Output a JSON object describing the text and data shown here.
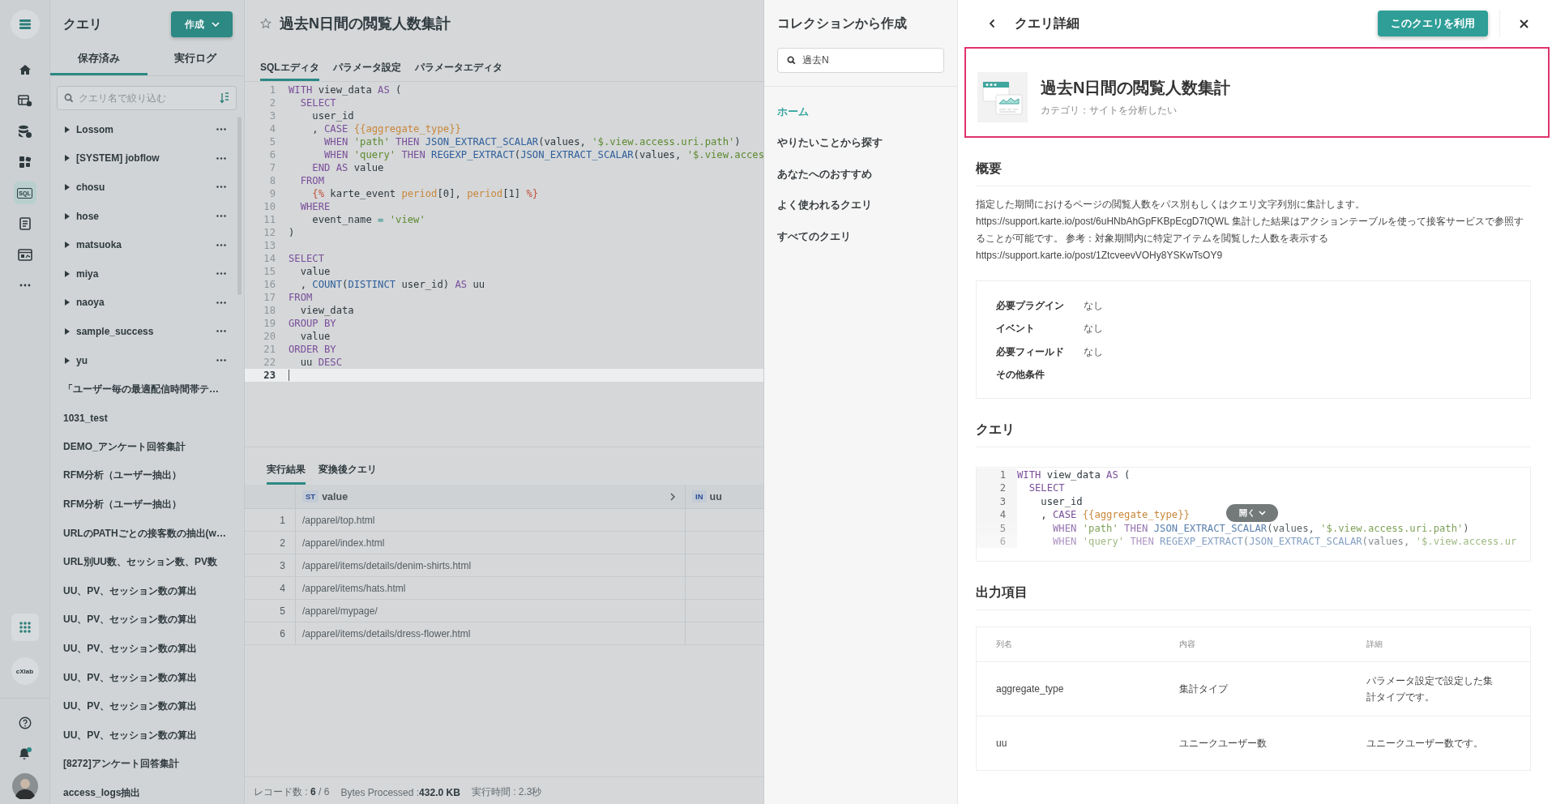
{
  "rail": {
    "items": [
      {
        "kind": "home",
        "selected": false
      },
      {
        "kind": "table",
        "selected": false
      },
      {
        "kind": "database",
        "selected": false
      },
      {
        "kind": "puzzle",
        "selected": false
      },
      {
        "kind": "sql",
        "label": "SQL",
        "selected": true
      },
      {
        "kind": "document",
        "selected": false
      },
      {
        "kind": "dashboard",
        "selected": false
      },
      {
        "kind": "more",
        "selected": false
      }
    ],
    "bottom": [
      {
        "kind": "apps"
      },
      {
        "kind": "project",
        "label": "cXlab"
      },
      {
        "kind": "help"
      },
      {
        "kind": "notifications",
        "badge": true
      },
      {
        "kind": "avatar"
      }
    ]
  },
  "sidebar": {
    "title": "クエリ",
    "create_button": "作成",
    "tabs": [
      {
        "label": "保存済み",
        "selected": true
      },
      {
        "label": "実行ログ",
        "selected": false
      }
    ],
    "search": {
      "placeholder": "クエリ名で絞り込む"
    },
    "items": [
      {
        "kind": "folder",
        "name": "Lossom"
      },
      {
        "kind": "folder",
        "name": "[SYSTEM] jobflow"
      },
      {
        "kind": "folder",
        "name": "chosu"
      },
      {
        "kind": "folder",
        "name": "hose"
      },
      {
        "kind": "folder",
        "name": "matsuoka"
      },
      {
        "kind": "folder",
        "name": "miya"
      },
      {
        "kind": "folder",
        "name": "naoya"
      },
      {
        "kind": "folder",
        "name": "sample_success"
      },
      {
        "kind": "folder",
        "name": "yu"
      },
      {
        "kind": "query",
        "name": "「ユーザー毎の最適配信時間帯テ…"
      },
      {
        "kind": "query",
        "name": "1031_test"
      },
      {
        "kind": "query",
        "name": "DEMO_アンケート回答集計"
      },
      {
        "kind": "query",
        "name": "RFM分析（ユーザー抽出）"
      },
      {
        "kind": "query",
        "name": "RFM分析（ユーザー抽出）"
      },
      {
        "kind": "query",
        "name": "URLのPATHごとの接客数の抽出(w…"
      },
      {
        "kind": "query",
        "name": "URL別UU数、セッション数、PV数"
      },
      {
        "kind": "query",
        "name": "UU、PV、セッション数の算出"
      },
      {
        "kind": "query",
        "name": "UU、PV、セッション数の算出"
      },
      {
        "kind": "query",
        "name": "UU、PV、セッション数の算出"
      },
      {
        "kind": "query",
        "name": "UU、PV、セッション数の算出"
      },
      {
        "kind": "query",
        "name": "UU、PV、セッション数の算出"
      },
      {
        "kind": "query",
        "name": "UU、PV、セッション数の算出"
      },
      {
        "kind": "query",
        "name": "[8272]アンケート回答集計"
      },
      {
        "kind": "query",
        "name": "access_logs抽出"
      }
    ]
  },
  "editor": {
    "title": "過去N日間の閲覧人数集計",
    "starred": false,
    "tabs": [
      {
        "label": "SQLエディタ",
        "selected": true
      },
      {
        "label": "パラメータ設定",
        "selected": false
      },
      {
        "label": "パラメータエディタ",
        "selected": false
      }
    ],
    "lines": [
      {
        "number": "1",
        "current": false,
        "tokens": [
          {
            "kind": "kw",
            "text": "WITH"
          },
          {
            "kind": "txt",
            "text": " view_data "
          },
          {
            "kind": "kw",
            "text": "AS"
          },
          {
            "kind": "txt",
            "text": " ("
          }
        ]
      },
      {
        "number": "2",
        "current": false,
        "tokens": [
          {
            "kind": "kw",
            "text": "  SELECT"
          }
        ]
      },
      {
        "number": "3",
        "current": false,
        "tokens": [
          {
            "kind": "txt",
            "text": "    user_id"
          }
        ]
      },
      {
        "number": "4",
        "current": false,
        "tokens": [
          {
            "kind": "txt",
            "text": "    , "
          },
          {
            "kind": "kw",
            "text": "CASE"
          },
          {
            "kind": "tpl",
            "text": " {{aggregate_type}}"
          }
        ]
      },
      {
        "number": "5",
        "current": false,
        "tokens": [
          {
            "kind": "kw",
            "text": "      WHEN"
          },
          {
            "kind": "str",
            "text": " 'path'"
          },
          {
            "kind": "kw",
            "text": " THEN"
          },
          {
            "kind": "fn",
            "text": " JSON_EXTRACT_SCALAR"
          },
          {
            "kind": "txt",
            "text": "(values, "
          },
          {
            "kind": "str",
            "text": "'$.view.access.uri.path'"
          },
          {
            "kind": "txt",
            "text": ")"
          }
        ]
      },
      {
        "number": "6",
        "current": false,
        "tokens": [
          {
            "kind": "kw",
            "text": "      WHEN"
          },
          {
            "kind": "str",
            "text": " 'query'"
          },
          {
            "kind": "kw",
            "text": " THEN"
          },
          {
            "kind": "fn",
            "text": " REGEXP_EXTRACT"
          },
          {
            "kind": "txt",
            "text": "("
          },
          {
            "kind": "fn",
            "text": "JSON_EXTRACT_SCALAR"
          },
          {
            "kind": "txt",
            "text": "(values, "
          },
          {
            "kind": "str",
            "text": "'$.view.acces"
          }
        ]
      },
      {
        "number": "7",
        "current": false,
        "tokens": [
          {
            "kind": "kw",
            "text": "    END AS"
          },
          {
            "kind": "txt",
            "text": " value"
          }
        ]
      },
      {
        "number": "8",
        "current": false,
        "tokens": [
          {
            "kind": "kw",
            "text": "  FROM"
          }
        ]
      },
      {
        "number": "9",
        "current": false,
        "tokens": [
          {
            "kind": "tag",
            "text": "    {%"
          },
          {
            "kind": "txt",
            "text": " karte_event "
          },
          {
            "kind": "tpl",
            "text": "period"
          },
          {
            "kind": "txt",
            "text": "[0], "
          },
          {
            "kind": "tpl",
            "text": "period"
          },
          {
            "kind": "txt",
            "text": "[1] "
          },
          {
            "kind": "tag",
            "text": "%}"
          }
        ]
      },
      {
        "number": "10",
        "current": false,
        "tokens": [
          {
            "kind": "kw",
            "text": "  WHERE"
          }
        ]
      },
      {
        "number": "11",
        "current": false,
        "tokens": [
          {
            "kind": "txt",
            "text": "    event_name "
          },
          {
            "kind": "op",
            "text": "="
          },
          {
            "kind": "str",
            "text": " 'view'"
          }
        ]
      },
      {
        "number": "12",
        "current": false,
        "tokens": [
          {
            "kind": "txt",
            "text": ")"
          }
        ]
      },
      {
        "number": "13",
        "current": false
      },
      {
        "number": "14",
        "current": false,
        "tokens": [
          {
            "kind": "kw",
            "text": "SELECT"
          }
        ]
      },
      {
        "number": "15",
        "current": false,
        "tokens": [
          {
            "kind": "txt",
            "text": "  value"
          }
        ]
      },
      {
        "number": "16",
        "current": false,
        "tokens": [
          {
            "kind": "txt",
            "text": "  , "
          },
          {
            "kind": "fn",
            "text": "COUNT"
          },
          {
            "kind": "txt",
            "text": "("
          },
          {
            "kind": "fn",
            "text": "DISTINCT"
          },
          {
            "kind": "txt",
            "text": " user_id) "
          },
          {
            "kind": "kw",
            "text": "AS"
          },
          {
            "kind": "txt",
            "text": " uu"
          }
        ]
      },
      {
        "number": "17",
        "current": false,
        "tokens": [
          {
            "kind": "kw",
            "text": "FROM"
          }
        ]
      },
      {
        "number": "18",
        "current": false,
        "tokens": [
          {
            "kind": "txt",
            "text": "  view_data"
          }
        ]
      },
      {
        "number": "19",
        "current": false,
        "tokens": [
          {
            "kind": "kw",
            "text": "GROUP BY"
          }
        ]
      },
      {
        "number": "20",
        "current": false,
        "tokens": [
          {
            "kind": "txt",
            "text": "  value"
          }
        ]
      },
      {
        "number": "21",
        "current": false,
        "tokens": [
          {
            "kind": "kw",
            "text": "ORDER BY"
          }
        ]
      },
      {
        "number": "22",
        "current": false,
        "tokens": [
          {
            "kind": "txt",
            "text": "  uu "
          },
          {
            "kind": "kw",
            "text": "DESC"
          }
        ]
      },
      {
        "number": "23",
        "current": true
      }
    ]
  },
  "results": {
    "tabs": [
      {
        "label": "実行結果",
        "selected": true
      },
      {
        "label": "変換後クエリ",
        "selected": false
      }
    ],
    "columns": [
      {
        "type": "ST",
        "name": "value"
      },
      {
        "type": "IN",
        "name": "uu"
      }
    ],
    "rows": [
      {
        "number": "1",
        "value": "/apparel/top.html"
      },
      {
        "number": "2",
        "value": "/apparel/index.html"
      },
      {
        "number": "3",
        "value": "/apparel/items/details/denim-shirts.html"
      },
      {
        "number": "4",
        "value": "/apparel/items/hats.html"
      },
      {
        "number": "5",
        "value": "/apparel/mypage/"
      },
      {
        "number": "6",
        "value": "/apparel/items/details/dress-flower.html"
      }
    ],
    "status": [
      "レコード数 : **6** / 6",
      "Bytes Processed :**432.0 KB**",
      "実行時間 : 2.3秒"
    ]
  },
  "collection": {
    "title": "コレクションから作成",
    "search": {
      "value": "過去N"
    },
    "nav": [
      {
        "label": "ホーム",
        "selected": true
      },
      {
        "label": "やりたいことから探す",
        "selected": false
      },
      {
        "label": "あなたへのおすすめ",
        "selected": false
      },
      {
        "label": "よく使われるクエリ",
        "selected": false
      },
      {
        "label": "すべてのクエリ",
        "selected": false
      }
    ]
  },
  "detail": {
    "title": "クエリ詳細",
    "use_button": "このクエリを利用",
    "card": {
      "title": "過去N日間の閲覧人数集計",
      "category": "カテゴリ：サイトを分析したい",
      "highlighted": true
    },
    "overview": {
      "heading": "概要",
      "description": "指定した期間におけるページの閲覧人数をパス別もしくはクエリ文字列別に集計します。 https://support.karte.io/post/6uHNbAhGpFKBpEcgD7tQWL 集計した結果はアクションテーブルを使って接客サービスで参照することが可能です。 参考：対象期間内に特定アイテムを閲覧した人数を表示する https://support.karte.io/post/1ZtcveevVOHy8YSKwTsOY9",
      "requirements": [
        {
          "label": "必要プラグイン",
          "value": "なし"
        },
        {
          "label": "イベント",
          "value": "なし"
        },
        {
          "label": "必要フィールド",
          "value": "なし"
        },
        {
          "label": "その他条件"
        }
      ]
    },
    "query": {
      "heading": "クエリ",
      "expand_button": "開く",
      "lines": [
        {
          "number": "1",
          "tokens": [
            {
              "kind": "kw",
              "text": "WITH"
            },
            {
              "kind": "txt",
              "text": " view_data "
            },
            {
              "kind": "kw",
              "text": "AS"
            },
            {
              "kind": "txt",
              "text": " ("
            }
          ]
        },
        {
          "number": "2",
          "tokens": [
            {
              "kind": "kw",
              "text": "  SELECT"
            }
          ]
        },
        {
          "number": "3",
          "tokens": [
            {
              "kind": "txt",
              "text": "    user_id"
            }
          ]
        },
        {
          "number": "4",
          "tokens": [
            {
              "kind": "txt",
              "text": "    , "
            },
            {
              "kind": "kw",
              "text": "CASE"
            },
            {
              "kind": "tpl",
              "text": " {{aggregate_type}}"
            }
          ]
        },
        {
          "number": "5",
          "tokens": [
            {
              "kind": "kw",
              "text": "      WHEN"
            },
            {
              "kind": "str",
              "text": " 'path'"
            },
            {
              "kind": "kw",
              "text": " THEN"
            },
            {
              "kind": "fn",
              "text": " JSON_EXTRACT_SCALAR"
            },
            {
              "kind": "txt",
              "text": "(values, "
            },
            {
              "kind": "str",
              "text": "'$.view.access.uri.path'"
            },
            {
              "kind": "txt",
              "text": ")"
            }
          ]
        },
        {
          "number": "6",
          "tokens": [
            {
              "kind": "kw",
              "text": "      WHEN"
            },
            {
              "kind": "str",
              "text": " 'query'"
            },
            {
              "kind": "kw",
              "text": " THEN"
            },
            {
              "kind": "fn",
              "text": " REGEXP_EXTRACT"
            },
            {
              "kind": "txt",
              "text": "("
            },
            {
              "kind": "fn",
              "text": "JSON_EXTRACT_SCALAR"
            },
            {
              "kind": "txt",
              "text": "(values, "
            },
            {
              "kind": "str",
              "text": "'$.view.access.ur"
            }
          ]
        }
      ]
    },
    "output": {
      "heading": "出力項目",
      "columns": [
        "列名",
        "内容",
        "詳細"
      ],
      "rows": [
        [
          "aggregate_type",
          "集計タイプ",
          "パラメータ設定で設定した集計タイプです。"
        ],
        [
          "uu",
          "ユニークユーザー数",
          "ユニークユーザー数です。"
        ]
      ]
    }
  }
}
